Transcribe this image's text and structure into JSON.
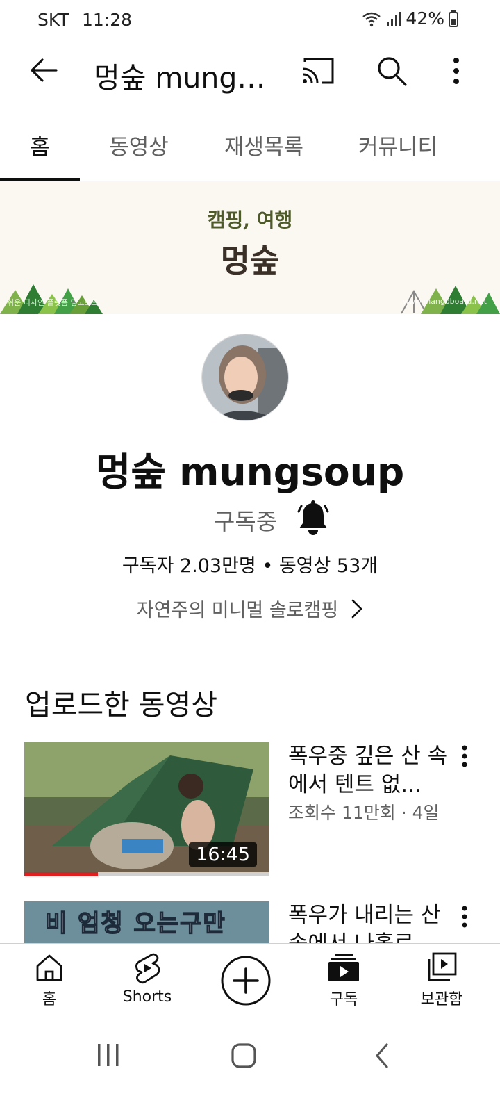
{
  "status_bar": {
    "carrier": "SKT",
    "time": "11:28",
    "battery": "42%"
  },
  "app_bar": {
    "title": "멍숲 mungs...",
    "icons": [
      "back-arrow-icon",
      "cast-icon",
      "search-icon",
      "more-vert-icon"
    ]
  },
  "tabs": [
    {
      "label": "홈",
      "active": true
    },
    {
      "label": "동영상",
      "active": false
    },
    {
      "label": "재생목록",
      "active": false
    },
    {
      "label": "커뮤니티",
      "active": false
    }
  ],
  "banner": {
    "subtitle": "캠핑, 여행",
    "title": "멍숲",
    "left_small_text": "쉬운 디자인 플랫폼 망고보드",
    "right_small_text": "www.mangoboard.net"
  },
  "channel": {
    "name": "멍숲 mungsoup",
    "subscribe_state": "구독중",
    "stats": "구독자 2.03만명 • 동영상 53개",
    "tagline": "자연주의 미니멀 솔로캠핑"
  },
  "section_title": "업로드한 동영상",
  "videos": [
    {
      "title": "폭우중 깊은 산 속에서 텐트 없...",
      "meta": "조회수 11만회 · 4일 전",
      "duration": "16:45",
      "progress_fraction": 0.3
    },
    {
      "title": "폭우가 내리는 산 속에서 나홀로",
      "thumb_caption": "비 엄청 오는구만"
    }
  ],
  "bottom_nav": [
    {
      "label": "홈",
      "icon": "home-icon"
    },
    {
      "label": "Shorts",
      "icon": "shorts-icon"
    },
    {
      "label": "",
      "icon": "create-plus-icon"
    },
    {
      "label": "구독",
      "icon": "subscriptions-icon"
    },
    {
      "label": "보관함",
      "icon": "library-icon"
    }
  ],
  "system_nav": [
    "recent-apps-icon",
    "home-circle-icon",
    "system-back-icon"
  ]
}
